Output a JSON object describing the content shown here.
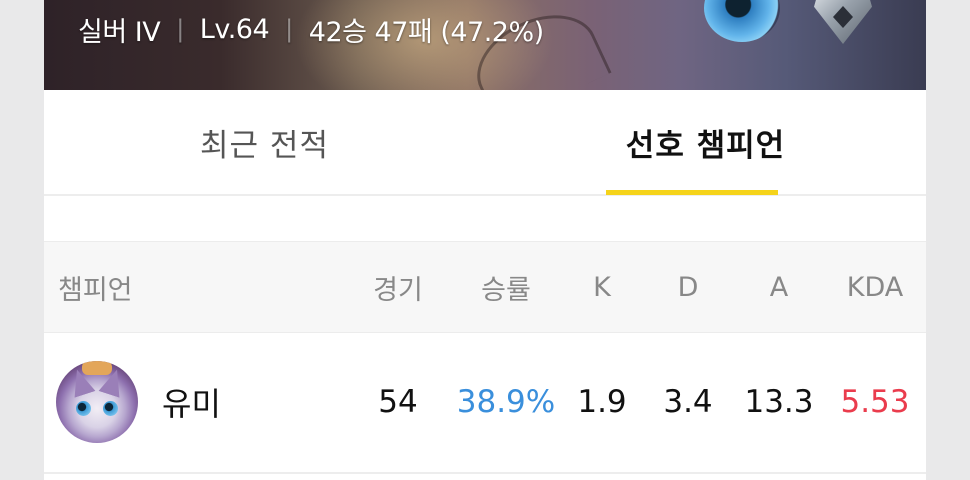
{
  "summary": {
    "tier": "실버 IV",
    "level": "Lv.64",
    "record": "42승 47패 (47.2%)"
  },
  "tabs": [
    {
      "label": "최근 전적",
      "active": false
    },
    {
      "label": "선호 챔피언",
      "active": true
    }
  ],
  "table": {
    "headers": {
      "champion": "챔피언",
      "games": "경기",
      "winrate": "승률",
      "k": "K",
      "d": "D",
      "a": "A",
      "kda": "KDA"
    },
    "rows": [
      {
        "champion": "유미",
        "avatar_icon": "yuumi-avatar-icon",
        "games": "54",
        "winrate": "38.9%",
        "k": "1.9",
        "d": "3.4",
        "a": "13.3",
        "kda": "5.53"
      }
    ]
  },
  "colors": {
    "accent": "#f5d31a",
    "winrate": "#3a8fdc",
    "kda": "#ea3c4d"
  }
}
